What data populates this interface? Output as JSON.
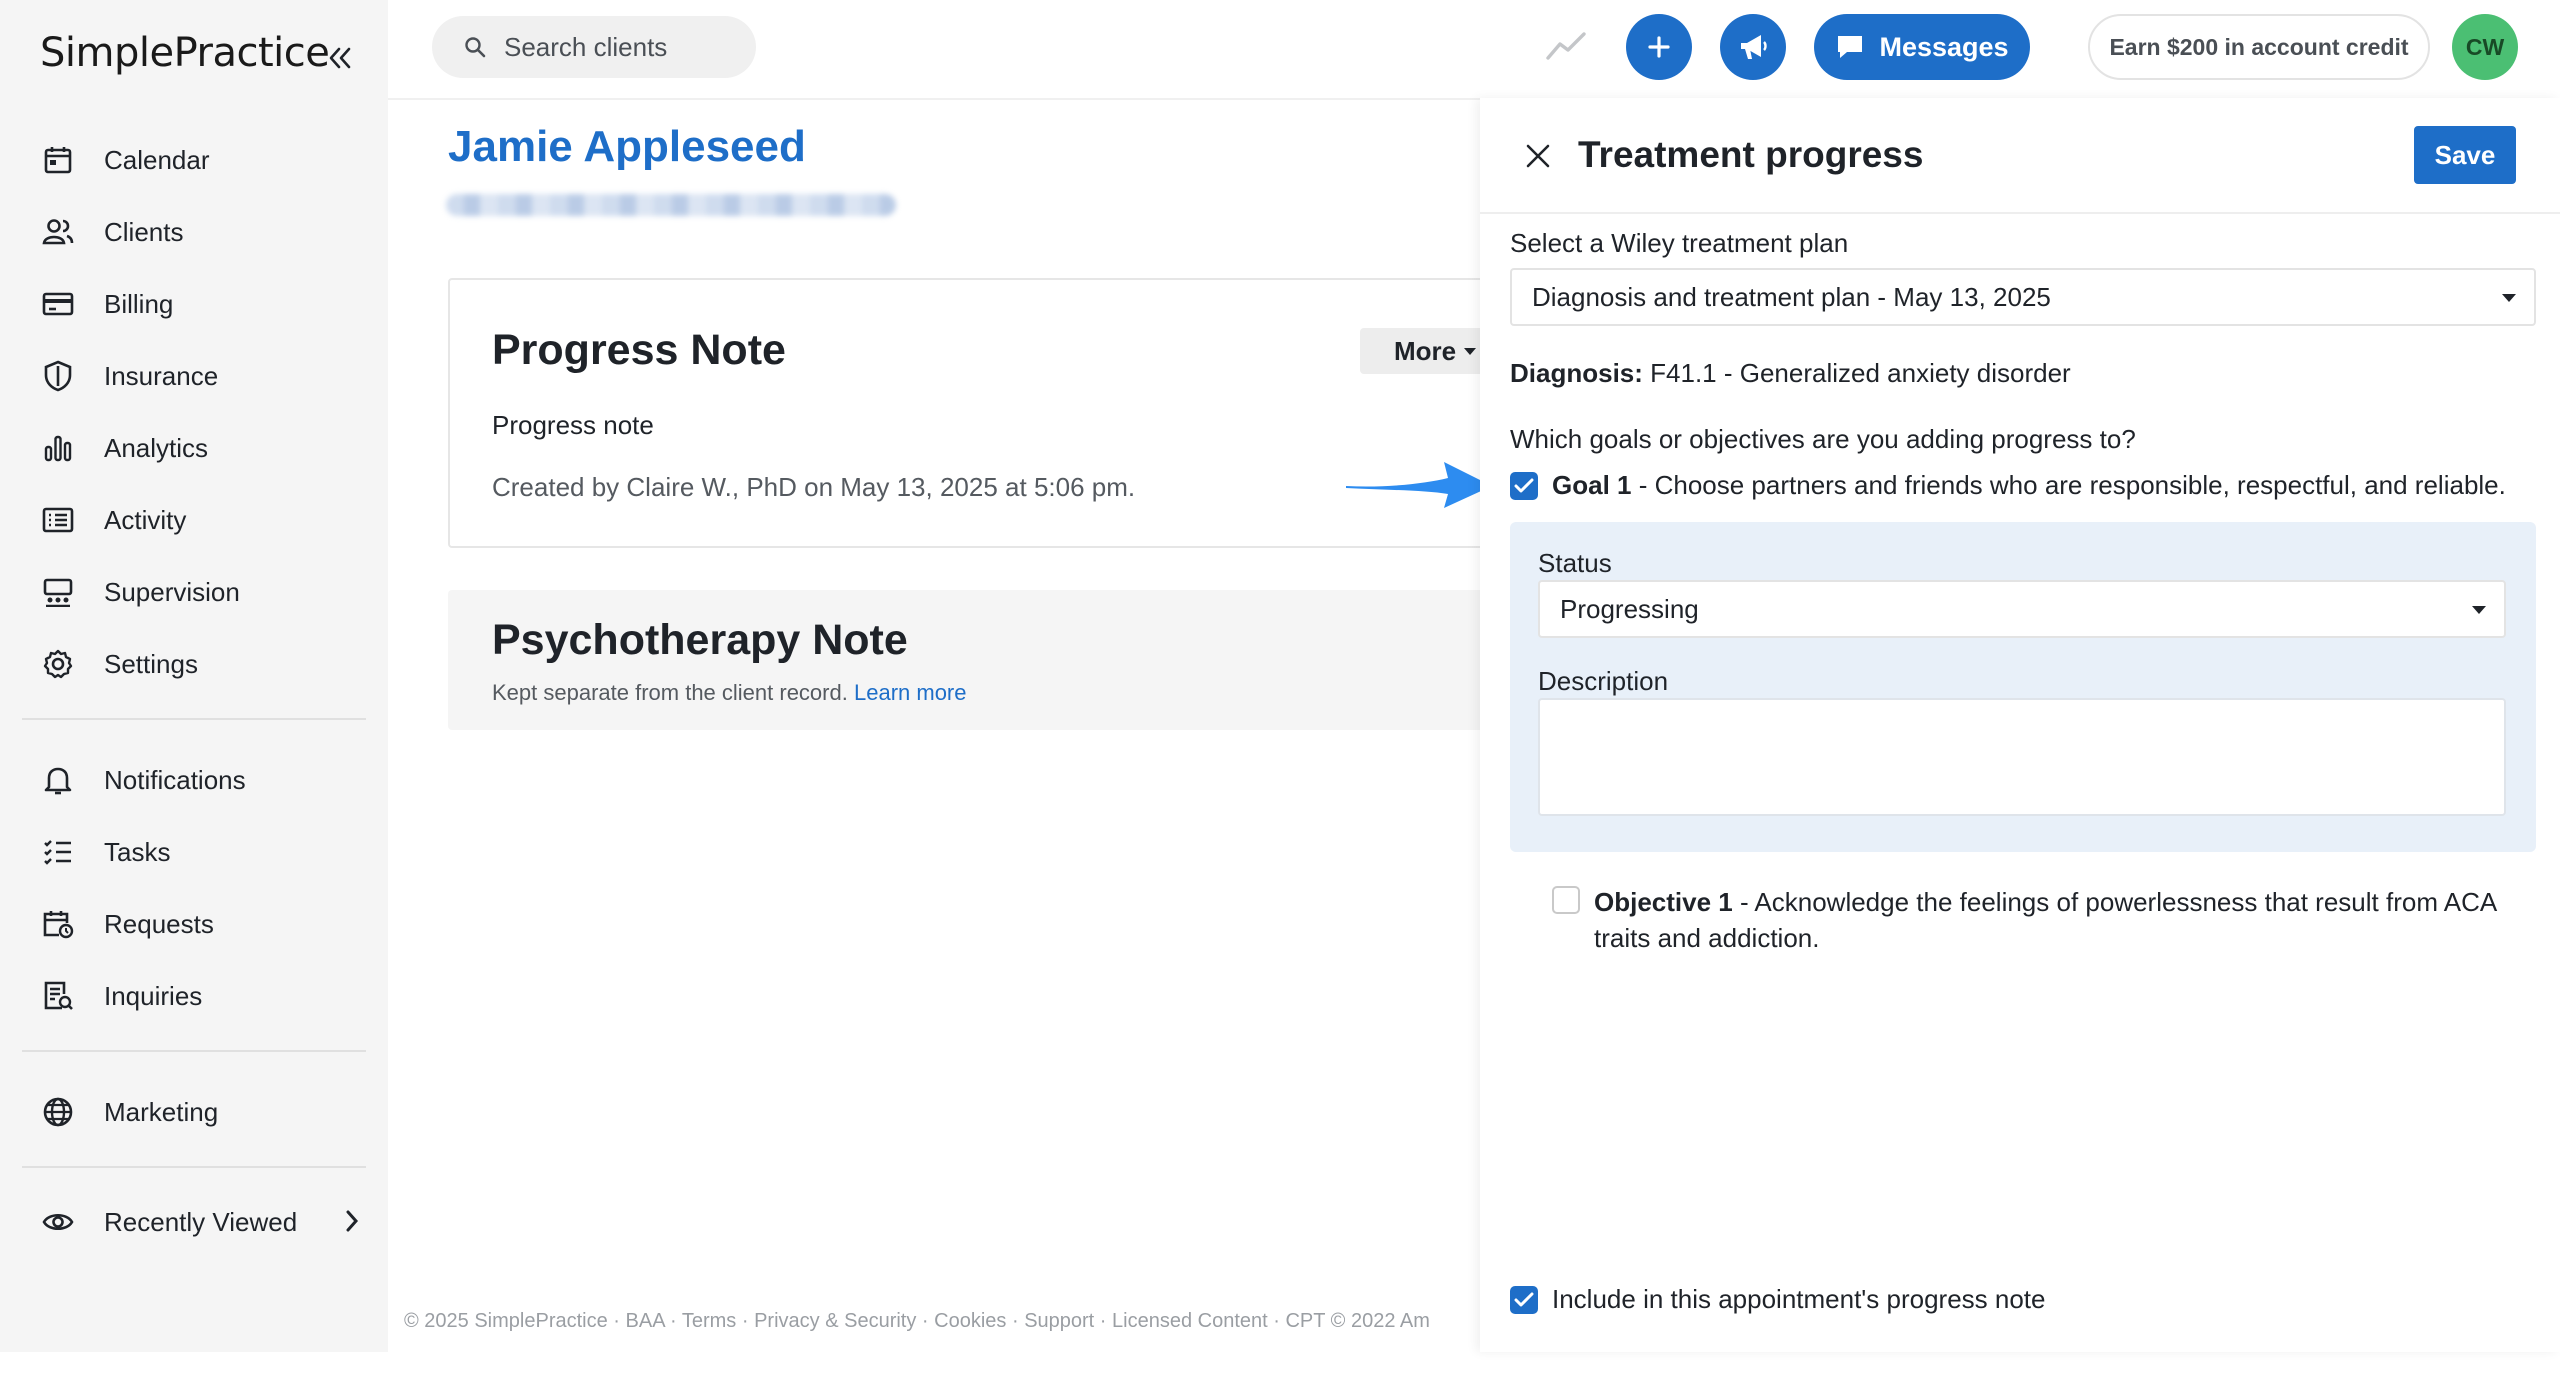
{
  "sidebar": {
    "logo": "SimplePractice",
    "items": [
      {
        "label": "Calendar",
        "icon": "calendar-icon"
      },
      {
        "label": "Clients",
        "icon": "clients-icon"
      },
      {
        "label": "Billing",
        "icon": "billing-icon"
      },
      {
        "label": "Insurance",
        "icon": "shield-icon"
      },
      {
        "label": "Analytics",
        "icon": "bar-chart-icon"
      },
      {
        "label": "Activity",
        "icon": "activity-list-icon"
      },
      {
        "label": "Supervision",
        "icon": "supervision-icon"
      },
      {
        "label": "Settings",
        "icon": "gear-icon"
      },
      {
        "label": "Notifications",
        "icon": "bell-icon"
      },
      {
        "label": "Tasks",
        "icon": "tasks-icon"
      },
      {
        "label": "Requests",
        "icon": "calendar-request-icon"
      },
      {
        "label": "Inquiries",
        "icon": "inquiries-icon"
      },
      {
        "label": "Marketing",
        "icon": "globe-icon"
      },
      {
        "label": "Recently Viewed",
        "icon": "eye-icon"
      }
    ]
  },
  "topbar": {
    "search_placeholder": "Search clients",
    "messages_label": "Messages",
    "earn_label": "Earn $200 in account credit",
    "avatar_initials": "CW"
  },
  "client": {
    "name": "Jamie Appleseed"
  },
  "progress_card": {
    "title": "Progress Note",
    "more_label": "More",
    "subtitle": "Progress note",
    "meta": "Created by Claire W., PhD on May 13, 2025 at 5:06 pm."
  },
  "psychotherapy_card": {
    "title": "Psychotherapy Note",
    "subtitle": "Kept separate from the client record.",
    "link": "Learn more"
  },
  "footer": {
    "copyright": "© 2025 SimplePractice",
    "links": [
      "BAA",
      "Terms",
      "Privacy & Security",
      "Cookies",
      "Support",
      "Licensed Content",
      "CPT © 2022 Am"
    ]
  },
  "panel": {
    "title": "Treatment progress",
    "save_label": "Save",
    "plan_label": "Select a Wiley treatment plan",
    "plan_value": "Diagnosis and treatment plan - May 13, 2025",
    "diagnosis_label": "Diagnosis:",
    "diagnosis_value": "F41.1 - Generalized anxiety disorder",
    "goals_question": "Which goals or objectives are you adding progress to?",
    "goal": {
      "name": "Goal 1",
      "text": " - Choose partners and friends who are responsible, respectful, and reliable.",
      "checked": true
    },
    "status_label": "Status",
    "status_value": "Progressing",
    "description_label": "Description",
    "description_value": "",
    "objective": {
      "name": "Objective 1",
      "text": " - Acknowledge the feelings of powerlessness that result from ACA traits and addiction.",
      "checked": false
    },
    "include_label": "Include in this appointment's progress note",
    "include_checked": true
  },
  "colors": {
    "brand_blue": "#1e6ec8",
    "avatar_green": "#4bbf73",
    "goal_box_bg": "#e8f0f9"
  }
}
